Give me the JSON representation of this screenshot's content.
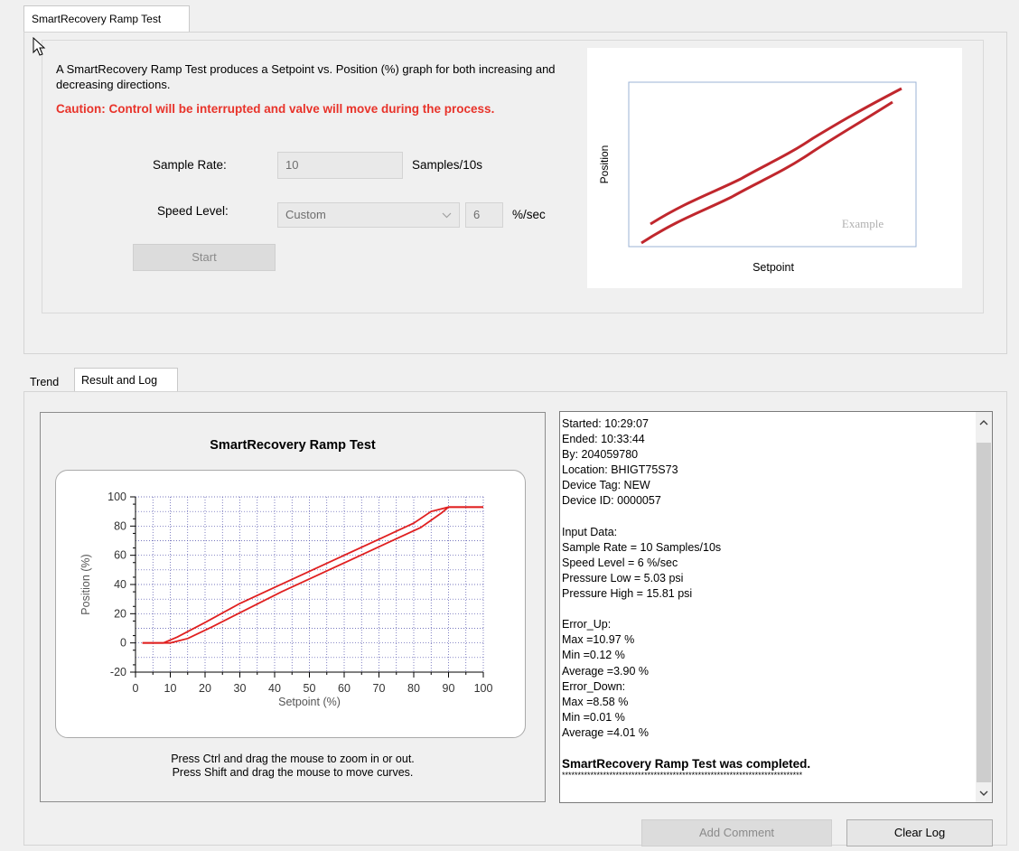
{
  "top_tab": {
    "label": "SmartRecovery Ramp Test"
  },
  "ramp_test": {
    "description": "A SmartRecovery Ramp Test produces a Setpoint vs. Position (%) graph for both increasing and decreasing directions.",
    "caution": "Caution: Control will be interrupted and valve will move during the process.",
    "sample_rate_label": "Sample Rate:",
    "sample_rate_value": "10",
    "sample_rate_unit": "Samples/10s",
    "speed_level_label": "Speed Level:",
    "speed_level_value": "Custom",
    "speed_custom_value": "6",
    "speed_unit": "%/sec",
    "start_button": "Start"
  },
  "example_graph": {
    "ylabel": "Position",
    "xlabel": "Setpoint",
    "watermark": "Example",
    "line_color": "#c0272d"
  },
  "bottom_tabs": [
    {
      "label": "Trend",
      "active": false
    },
    {
      "label": "Result and Log",
      "active": true
    }
  ],
  "chart_panel": {
    "hint_line1": "Press Ctrl and drag the mouse to zoom in or out.",
    "hint_line2": "Press Shift and drag the mouse to move curves."
  },
  "chart_data": {
    "type": "line",
    "title": "SmartRecovery Ramp Test",
    "xlabel": "Setpoint (%)",
    "ylabel": "Position (%)",
    "xlim": [
      0,
      100
    ],
    "ylim": [
      -20,
      100
    ],
    "x_ticks": [
      "0",
      "10",
      "20",
      "30",
      "40",
      "50",
      "60",
      "70",
      "80",
      "90",
      "100"
    ],
    "y_ticks": [
      "100",
      "80",
      "60",
      "40",
      "20",
      "0",
      "-20"
    ],
    "grid": true,
    "title_color": "#33338a",
    "series_color": "#e02020",
    "series": [
      {
        "x": [
          2,
          8,
          12,
          20,
          30,
          40,
          50,
          60,
          70,
          80,
          85,
          90,
          100
        ],
        "y": [
          0,
          0,
          4,
          14,
          27,
          38,
          49,
          60,
          71,
          82,
          90,
          93,
          93
        ]
      },
      {
        "x": [
          2,
          10,
          15,
          22,
          32,
          42,
          52,
          62,
          72,
          82,
          88,
          90,
          100
        ],
        "y": [
          0,
          0,
          3,
          11,
          23,
          35,
          46,
          57,
          68,
          79,
          89,
          93,
          93
        ]
      }
    ]
  },
  "log": {
    "lines": [
      "Started: 10:29:07",
      "Ended: 10:33:44",
      "By: 204059780",
      "Location: BHIGT75S73",
      "Device Tag: NEW",
      "Device ID: 0000057",
      "",
      "Input Data:",
      "Sample Rate = 10 Samples/10s",
      "Speed Level = 6 %/sec",
      "Pressure Low = 5.03 psi",
      "Pressure High = 15.81 psi",
      "",
      "Error_Up:",
      "Max =10.97 %",
      "Min =0.12 %",
      "Average =3.90 %",
      "Error_Down:",
      "Max =8.58 %",
      "Min =0.01 %",
      "Average =4.01 %",
      ""
    ],
    "completed": "SmartRecovery Ramp Test was completed.",
    "stars": "****************************************************************************"
  },
  "buttons": {
    "add_comment": "Add Comment",
    "clear_log": "Clear Log"
  }
}
